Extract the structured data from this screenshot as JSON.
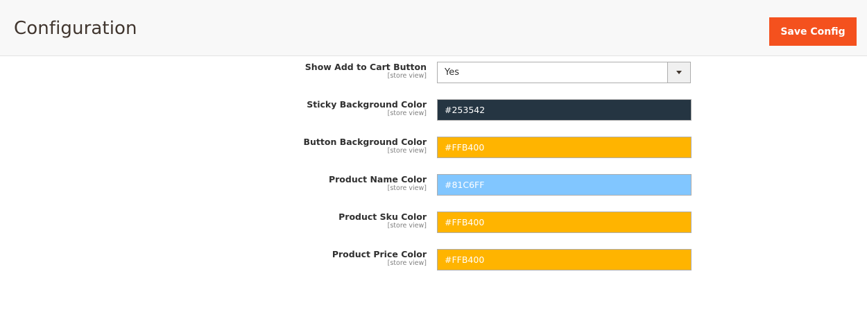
{
  "header": {
    "title": "Configuration",
    "save_label": "Save Config"
  },
  "fields": [
    {
      "label": "Show Add to Cart Button",
      "scope": "[store view]",
      "type": "select",
      "value": "Yes"
    },
    {
      "label": "Sticky Background Color",
      "scope": "[store view]",
      "type": "color",
      "value": "#253542",
      "bg": "#253542",
      "fg": "#ffffff"
    },
    {
      "label": "Button Background Color",
      "scope": "[store view]",
      "type": "color",
      "value": "#FFB400",
      "bg": "#FFB400",
      "fg": "#ffffff"
    },
    {
      "label": "Product Name Color",
      "scope": "[store view]",
      "type": "color",
      "value": "#81C6FF",
      "bg": "#81C6FF",
      "fg": "#ffffff"
    },
    {
      "label": "Product Sku Color",
      "scope": "[store view]",
      "type": "color",
      "value": "#FFB400",
      "bg": "#FFB400",
      "fg": "#ffffff"
    },
    {
      "label": "Product Price Color",
      "scope": "[store view]",
      "type": "color",
      "value": "#FFB400",
      "bg": "#FFB400",
      "fg": "#ffffff"
    }
  ],
  "colors": {
    "accent": "#f4511e"
  }
}
